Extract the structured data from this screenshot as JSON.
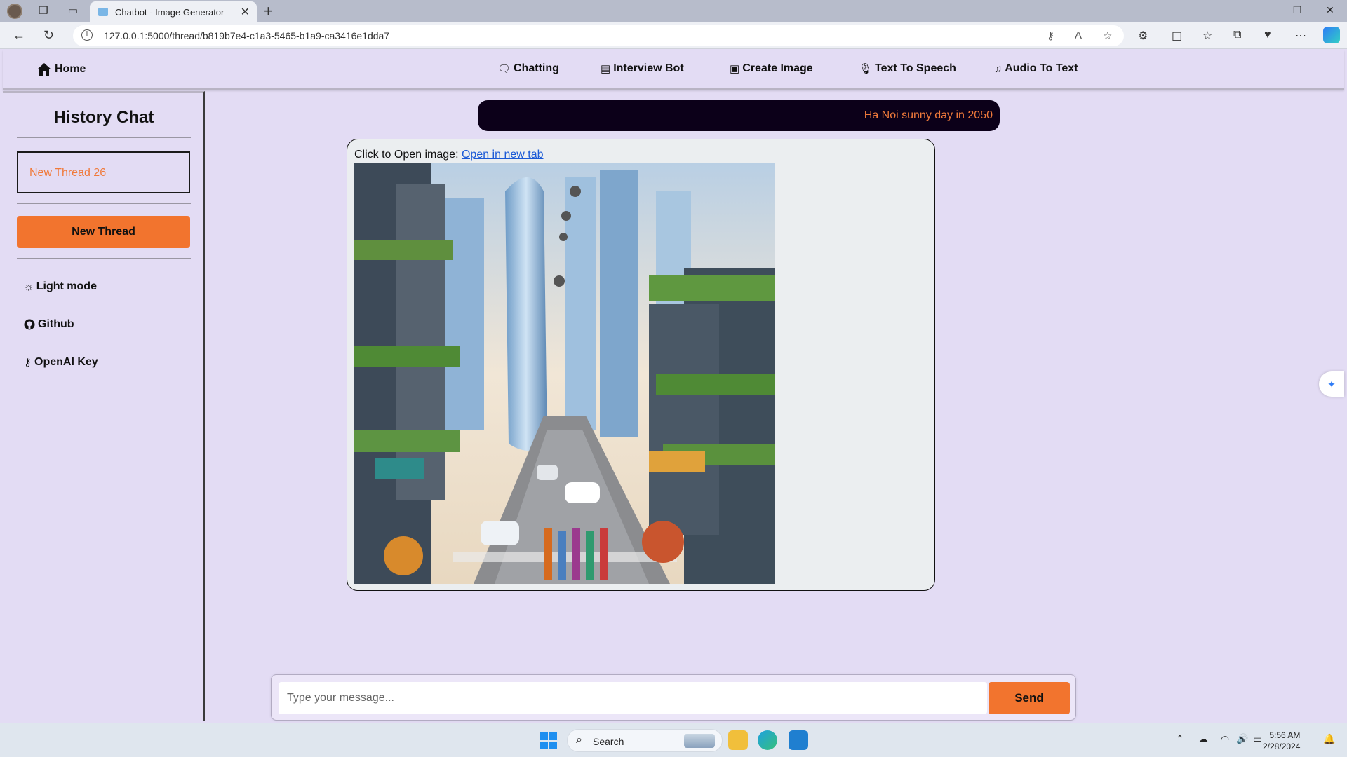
{
  "browser": {
    "tab_title": "Chatbot - Image Generator",
    "url": "127.0.0.1:5000/thread/b819b7e4-c1a3-5465-b1a9-ca3416e1dda7"
  },
  "nav": {
    "home": "Home",
    "chatting": "Chatting",
    "interview_bot": "Interview Bot",
    "create_image": "Create Image",
    "text_to_speech": "Text To Speech",
    "audio_to_text": "Audio To Text"
  },
  "sidebar": {
    "title": "History Chat",
    "threads": [
      "New Thread 26"
    ],
    "new_thread_button": "New Thread",
    "light_mode": "Light mode",
    "github": "Github",
    "openai_key": "OpenAI Key"
  },
  "main": {
    "prompt": "Ha Noi sunny day in 2050",
    "open_label": "Click to Open image:",
    "open_link": "Open in new tab"
  },
  "composer": {
    "placeholder": "Type your message...",
    "send_label": "Send"
  },
  "taskbar": {
    "search_label": "Search",
    "time": "5:56 AM",
    "date": "2/28/2024"
  },
  "colors": {
    "accent": "#f2742e",
    "background": "#e3dcf4",
    "prompt_bubble": "#0c0019",
    "prompt_text": "#f07a3b",
    "link": "#1a59d6"
  }
}
